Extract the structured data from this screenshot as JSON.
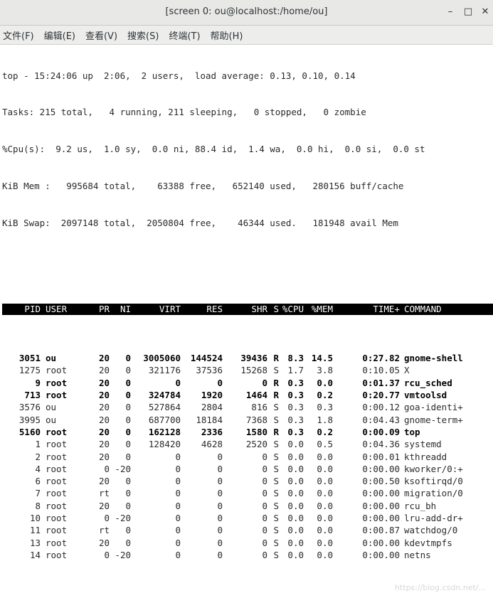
{
  "window": {
    "title": "[screen 0: ou@localhost:/home/ou]",
    "minimize": "–",
    "maximize": "□",
    "close": "✕"
  },
  "menu": [
    "文件(F)",
    "编辑(E)",
    "查看(V)",
    "搜索(S)",
    "终端(T)",
    "帮助(H)"
  ],
  "summary": [
    "top - 15:24:06 up  2:06,  2 users,  load average: 0.13, 0.10, 0.14",
    "Tasks: 215 total,   4 running, 211 sleeping,   0 stopped,   0 zombie",
    "%Cpu(s):  9.2 us,  1.0 sy,  0.0 ni, 88.4 id,  1.4 wa,  0.0 hi,  0.0 si,  0.0 st",
    "KiB Mem :   995684 total,    63388 free,   652140 used,   280156 buff/cache",
    "KiB Swap:  2097148 total,  2050804 free,    46344 used.   181948 avail Mem"
  ],
  "columns": [
    "PID",
    "USER",
    "PR",
    "NI",
    "VIRT",
    "RES",
    "SHR",
    "S",
    "%CPU",
    "%MEM",
    "TIME+",
    "COMMAND"
  ],
  "processes": [
    [
      "3051",
      "ou",
      "20",
      "0",
      "3005060",
      "144524",
      "39436",
      "R",
      "8.3",
      "14.5",
      "0:27.82",
      "gnome-shell"
    ],
    [
      "1275",
      "root",
      "20",
      "0",
      "321176",
      "37536",
      "15268",
      "S",
      "1.7",
      "3.8",
      "0:10.05",
      "X"
    ],
    [
      "9",
      "root",
      "20",
      "0",
      "0",
      "0",
      "0",
      "R",
      "0.3",
      "0.0",
      "0:01.37",
      "rcu_sched"
    ],
    [
      "713",
      "root",
      "20",
      "0",
      "324784",
      "1920",
      "1464",
      "R",
      "0.3",
      "0.2",
      "0:20.77",
      "vmtoolsd"
    ],
    [
      "3576",
      "ou",
      "20",
      "0",
      "527864",
      "2804",
      "816",
      "S",
      "0.3",
      "0.3",
      "0:00.12",
      "goa-identi+"
    ],
    [
      "3995",
      "ou",
      "20",
      "0",
      "687700",
      "18184",
      "7368",
      "S",
      "0.3",
      "1.8",
      "0:04.43",
      "gnome-term+"
    ],
    [
      "5160",
      "root",
      "20",
      "0",
      "162128",
      "2336",
      "1580",
      "R",
      "0.3",
      "0.2",
      "0:00.09",
      "top"
    ],
    [
      "1",
      "root",
      "20",
      "0",
      "128420",
      "4628",
      "2520",
      "S",
      "0.0",
      "0.5",
      "0:04.36",
      "systemd"
    ],
    [
      "2",
      "root",
      "20",
      "0",
      "0",
      "0",
      "0",
      "S",
      "0.0",
      "0.0",
      "0:00.01",
      "kthreadd"
    ],
    [
      "4",
      "root",
      "0",
      "-20",
      "0",
      "0",
      "0",
      "S",
      "0.0",
      "0.0",
      "0:00.00",
      "kworker/0:+"
    ],
    [
      "6",
      "root",
      "20",
      "0",
      "0",
      "0",
      "0",
      "S",
      "0.0",
      "0.0",
      "0:00.50",
      "ksoftirqd/0"
    ],
    [
      "7",
      "root",
      "rt",
      "0",
      "0",
      "0",
      "0",
      "S",
      "0.0",
      "0.0",
      "0:00.00",
      "migration/0"
    ],
    [
      "8",
      "root",
      "20",
      "0",
      "0",
      "0",
      "0",
      "S",
      "0.0",
      "0.0",
      "0:00.00",
      "rcu_bh"
    ],
    [
      "10",
      "root",
      "0",
      "-20",
      "0",
      "0",
      "0",
      "S",
      "0.0",
      "0.0",
      "0:00.00",
      "lru-add-dr+"
    ],
    [
      "11",
      "root",
      "rt",
      "0",
      "0",
      "0",
      "0",
      "S",
      "0.0",
      "0.0",
      "0:00.87",
      "watchdog/0"
    ],
    [
      "13",
      "root",
      "20",
      "0",
      "0",
      "0",
      "0",
      "S",
      "0.0",
      "0.0",
      "0:00.00",
      "kdevtmpfs"
    ],
    [
      "14",
      "root",
      "0",
      "-20",
      "0",
      "0",
      "0",
      "S",
      "0.0",
      "0.0",
      "0:00.00",
      "netns"
    ]
  ],
  "bold_rows": [
    0,
    2,
    3,
    6
  ],
  "watermark": "https://blog.csdn.net/..."
}
